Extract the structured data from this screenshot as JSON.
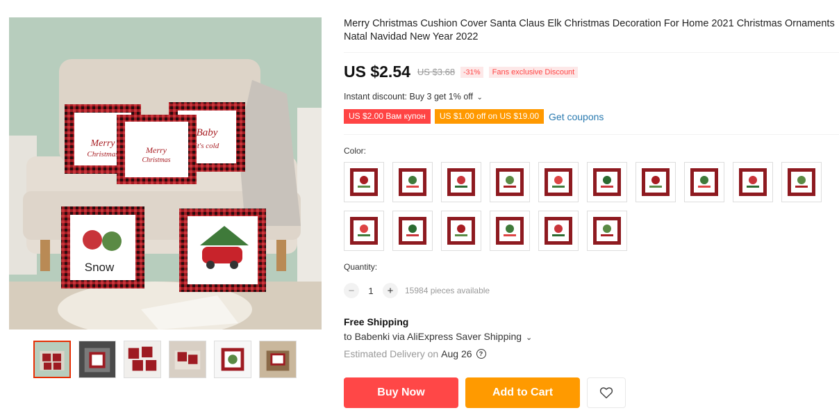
{
  "product": {
    "title": "Merry Christmas Cushion Cover Santa Claus Elk Christmas Decoration For Home 2021 Christmas Ornaments Natal Navidad New Year 2022"
  },
  "gallery": {
    "thumbnail_count": 6,
    "active_thumbnail": 1
  },
  "pricing": {
    "price": "US $2.54",
    "original_price": "US $3.68",
    "discount": "-31%",
    "fans_badge": "Fans exclusive Discount",
    "instant_discount": "Instant discount: Buy 3 get 1% off",
    "coupons": [
      "US $2.00 Вам купон",
      "US $1.00 off on US $19.00"
    ],
    "get_coupons_label": "Get coupons"
  },
  "color": {
    "label": "Color:",
    "option_count": 16,
    "selected": null
  },
  "quantity": {
    "label": "Quantity:",
    "minus": "−",
    "value": "1",
    "plus": "+",
    "available": "15984 pieces available"
  },
  "shipping": {
    "title": "Free Shipping",
    "to": "to Babenki via AliExpress Saver Shipping",
    "estimated_label": "Estimated Delivery on",
    "estimated_date": "Aug 26",
    "help_glyph": "?"
  },
  "actions": {
    "buy_now": "Buy Now",
    "add_to_cart": "Add to Cart",
    "wishlist_icon": "heart-icon"
  },
  "colors": {
    "price_red": "#ff4747",
    "cart_orange": "#ff9a00",
    "link_blue": "#2a7ab0",
    "plaid_red": "#9e1b22"
  }
}
